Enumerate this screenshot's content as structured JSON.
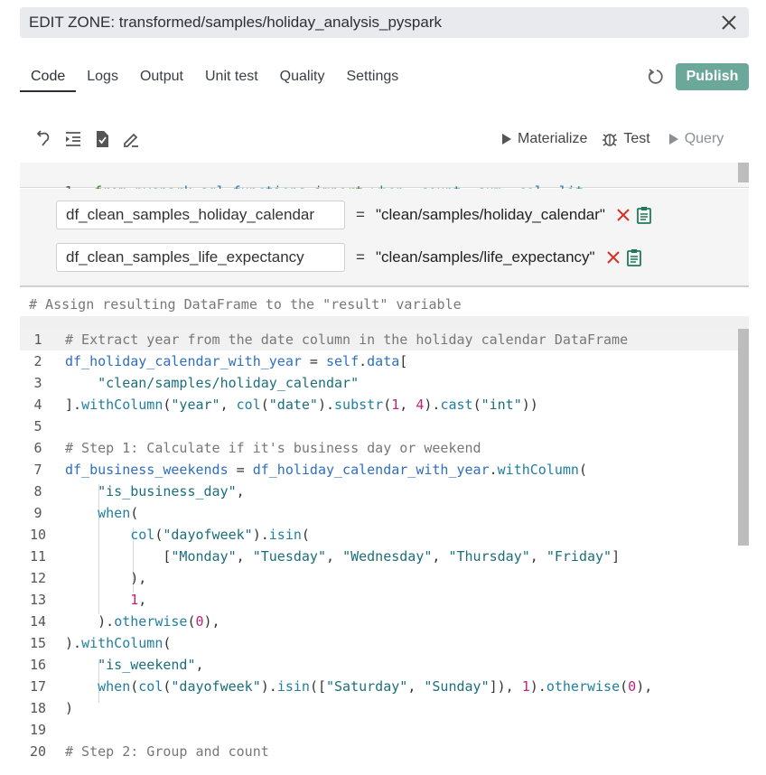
{
  "window": {
    "title": "EDIT ZONE: transformed/samples/holiday_analysis_pyspark"
  },
  "tabs": [
    {
      "label": "Code",
      "active": true
    },
    {
      "label": "Logs",
      "active": false
    },
    {
      "label": "Output",
      "active": false
    },
    {
      "label": "Unit test",
      "active": false
    },
    {
      "label": "Quality",
      "active": false
    },
    {
      "label": "Settings",
      "active": false
    }
  ],
  "actions": {
    "publish": "Publish",
    "materialize": "Materialize",
    "test": "Test",
    "query": "Query"
  },
  "import_line": {
    "number": "1",
    "text": "from pyspark.sql.functions import when, count, sum, col, lit"
  },
  "params": [
    {
      "name": "df_clean_samples_holiday_calendar",
      "value": "\"clean/samples/holiday_calendar\""
    },
    {
      "name": "df_clean_samples_life_expectancy",
      "value": "\"clean/samples/life_expectancy\""
    }
  ],
  "assign_comment": "# Assign resulting DataFrame to the \"result\" variable",
  "code_lines": [
    {
      "n": "1",
      "text": "# Extract year from the date column in the holiday calendar DataFrame"
    },
    {
      "n": "2",
      "text": "df_holiday_calendar_with_year = self.data["
    },
    {
      "n": "3",
      "text": "    \"clean/samples/holiday_calendar\""
    },
    {
      "n": "4",
      "text": "].withColumn(\"year\", col(\"date\").substr(1, 4).cast(\"int\"))"
    },
    {
      "n": "5",
      "text": ""
    },
    {
      "n": "6",
      "text": "# Step 1: Calculate if it's business day or weekend"
    },
    {
      "n": "7",
      "text": "df_business_weekends = df_holiday_calendar_with_year.withColumn("
    },
    {
      "n": "8",
      "text": "    \"is_business_day\","
    },
    {
      "n": "9",
      "text": "    when("
    },
    {
      "n": "10",
      "text": "        col(\"dayofweek\").isin("
    },
    {
      "n": "11",
      "text": "            [\"Monday\", \"Tuesday\", \"Wednesday\", \"Thursday\", \"Friday\"]"
    },
    {
      "n": "12",
      "text": "        ),"
    },
    {
      "n": "13",
      "text": "        1,"
    },
    {
      "n": "14",
      "text": "    ).otherwise(0),"
    },
    {
      "n": "15",
      "text": ").withColumn("
    },
    {
      "n": "16",
      "text": "    \"is_weekend\","
    },
    {
      "n": "17",
      "text": "    when(col(\"dayofweek\").isin([\"Saturday\", \"Sunday\"]), 1).otherwise(0),"
    },
    {
      "n": "18",
      "text": ")"
    },
    {
      "n": "19",
      "text": ""
    },
    {
      "n": "20",
      "text": "# Step 2: Group and count"
    }
  ],
  "colors": {
    "publish_bg": "#6ba89a",
    "remove_x": "#d93025",
    "clipboard": "#1f7a5c",
    "accent_kw": "#3a7d1f"
  }
}
